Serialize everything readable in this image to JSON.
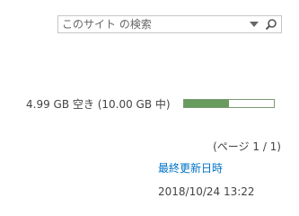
{
  "search": {
    "placeholder": "このサイト の検索",
    "dropdown_icon": "chevron-down-icon",
    "search_icon": "search-icon"
  },
  "storage": {
    "text": "4.99 GB 空き (10.00 GB 中)",
    "used_fraction": 0.5
  },
  "pagination": {
    "text": "(ページ 1 / 1)"
  },
  "last_modified": {
    "label": "最終更新日時",
    "value": "2018/10/24 13:22"
  },
  "colors": {
    "link": "#0072c6",
    "storage_fill": "#689b5e",
    "text": "#444444"
  }
}
